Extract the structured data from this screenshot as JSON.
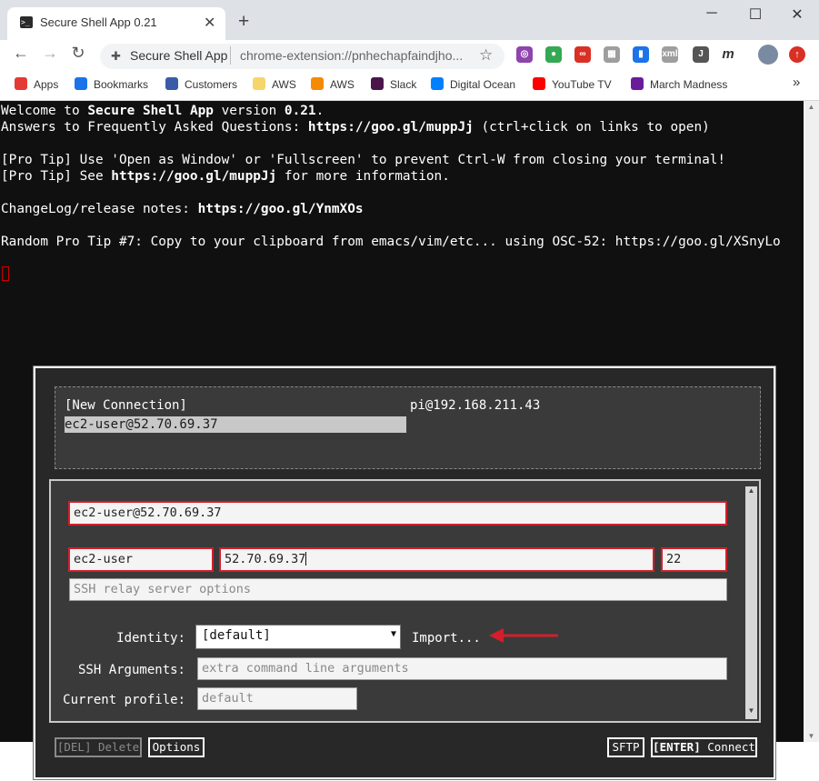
{
  "browser": {
    "tab_title": "Secure Shell App 0.21",
    "tab_icon": ">_",
    "new_tab": "+",
    "window": {
      "minimize": "─",
      "maximize": "☐",
      "close": "✕"
    },
    "omnibox": {
      "site": "Secure Shell App",
      "url": "chrome-extension://pnhechapfaindjho..."
    },
    "extensions": [
      {
        "name": "color-icon",
        "color": "#8e44ad",
        "glyph": "◎"
      },
      {
        "name": "maps-pin-icon",
        "color": "#34a853",
        "glyph": "●"
      },
      {
        "name": "creative-cloud-icon",
        "color": "#d93025",
        "glyph": "∞"
      },
      {
        "name": "grid-icon",
        "color": "#9e9e9e",
        "glyph": "▦"
      },
      {
        "name": "bookmark-ext-icon",
        "color": "#1a73e8",
        "glyph": "▮"
      },
      {
        "name": "xml-icon",
        "color": "#9e9e9e",
        "glyph": "xml"
      },
      {
        "name": "j-icon",
        "color": "#555555",
        "glyph": "J"
      },
      {
        "name": "m-icon",
        "color": "#ffffff",
        "glyph": "m"
      }
    ]
  },
  "bookmarks": [
    {
      "label": "Apps",
      "icon": "apps-grid-icon",
      "color": "#e53935"
    },
    {
      "label": "Bookmarks",
      "icon": "star-icon",
      "color": "#1a73e8"
    },
    {
      "label": "Customers",
      "icon": "cube-icon",
      "color": "#3b5ba9"
    },
    {
      "label": "AWS",
      "icon": "folder-icon",
      "color": "#f6d66b"
    },
    {
      "label": "AWS",
      "icon": "aws-cube-icon",
      "color": "#f58a07"
    },
    {
      "label": "Slack",
      "icon": "slack-icon",
      "color": "#4a154b"
    },
    {
      "label": "Digital Ocean",
      "icon": "digitalocean-icon",
      "color": "#0080ff"
    },
    {
      "label": "YouTube TV",
      "icon": "youtube-icon",
      "color": "#ff0000"
    },
    {
      "label": "March Madness",
      "icon": "march-madness-icon",
      "color": "#6a1b9a"
    }
  ],
  "bookmarks_more": "»",
  "terminal": {
    "lines": [
      [
        "Welcome to ",
        {
          "b": "Secure Shell App"
        },
        " version ",
        {
          "b": "0.21"
        },
        "."
      ],
      [
        "Answers to Frequently Asked Questions: ",
        {
          "b": "https://goo.gl/muppJj"
        },
        " (ctrl+click on links to open)"
      ],
      [
        ""
      ],
      [
        "[Pro Tip] Use 'Open as Window' or 'Fullscreen' to prevent Ctrl-W from closing your terminal!"
      ],
      [
        "[Pro Tip] See ",
        {
          "b": "https://goo.gl/muppJj"
        },
        " for more information."
      ],
      [
        ""
      ],
      [
        "ChangeLog/release notes: ",
        {
          "b": "https://goo.gl/YnmXOs"
        }
      ],
      [
        ""
      ],
      [
        "Random Pro Tip #7: Copy to your clipboard from emacs/vim/etc... using OSC-52: https://goo.gl/XSnyLo"
      ]
    ]
  },
  "dialog": {
    "profiles": [
      "[New Connection]",
      "ec2-user@52.70.69.37",
      "pi@192.168.211.43"
    ],
    "selected_profile": "ec2-user@52.70.69.37",
    "connection_title": "ec2-user@52.70.69.37",
    "username": "ec2-user",
    "hostname": "52.70.69.37",
    "port": "22",
    "relay_placeholder": "SSH relay server options",
    "identity_label": "Identity:",
    "identity_value": "[default]",
    "import_label": "Import...",
    "ssh_args_label": "SSH Arguments:",
    "ssh_args_placeholder": "extra command line arguments",
    "current_profile_label": "Current profile:",
    "current_profile_placeholder": "default",
    "buttons": {
      "delete": "[DEL] Delete",
      "options": "Options",
      "sftp": "SFTP",
      "connect_key": "[ENTER]",
      "connect": " Connect"
    },
    "arrow_color": "#d21f2b"
  }
}
